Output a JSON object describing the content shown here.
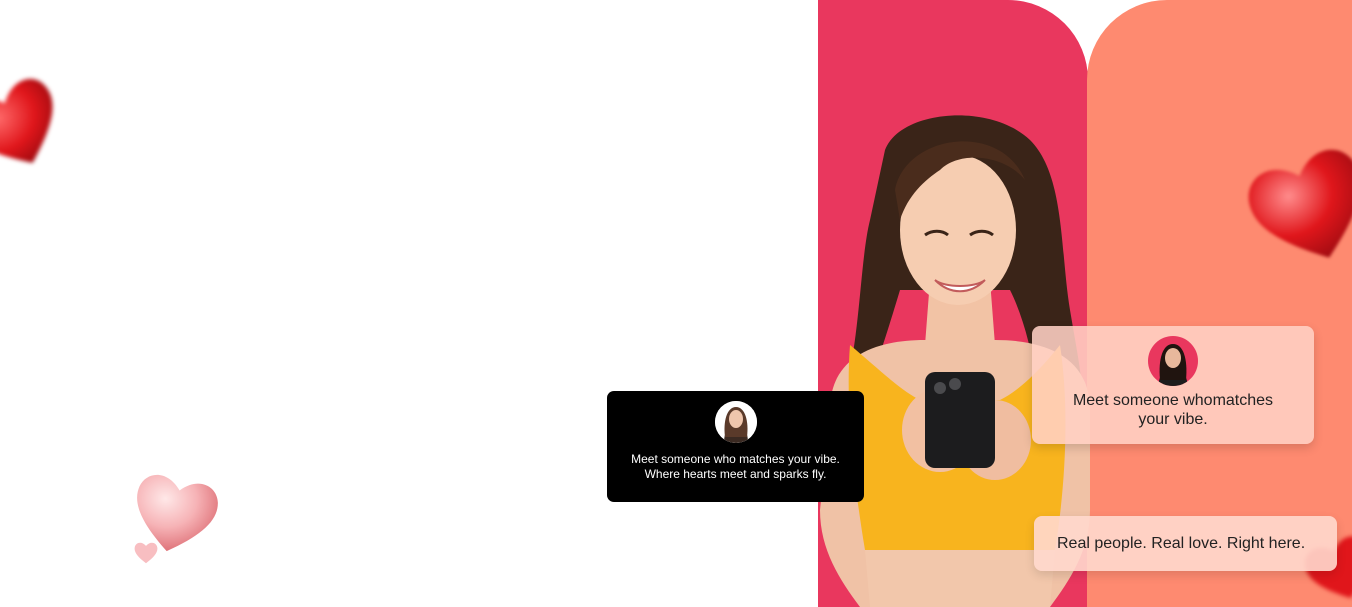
{
  "colors": {
    "panel_red": "#e9375e",
    "panel_coral": "#fe8a70",
    "dark_card": "#000000",
    "light_card": "rgba(255,208,196,0.88)",
    "pill_card": "rgba(255,216,205,0.9)",
    "heart": "#e0161b"
  },
  "icons": {
    "heart": "heart-icon",
    "avatar_dark": "profile-avatar-icon",
    "avatar_light": "profile-avatar-icon"
  },
  "cards": {
    "dark": {
      "line1": "Meet someone who matches your vibe.",
      "line2": "Where hearts meet and sparks fly."
    },
    "light": {
      "text": "Meet someone whomatches your vibe."
    },
    "pill": {
      "text": "Real people. Real love. Right here."
    }
  }
}
